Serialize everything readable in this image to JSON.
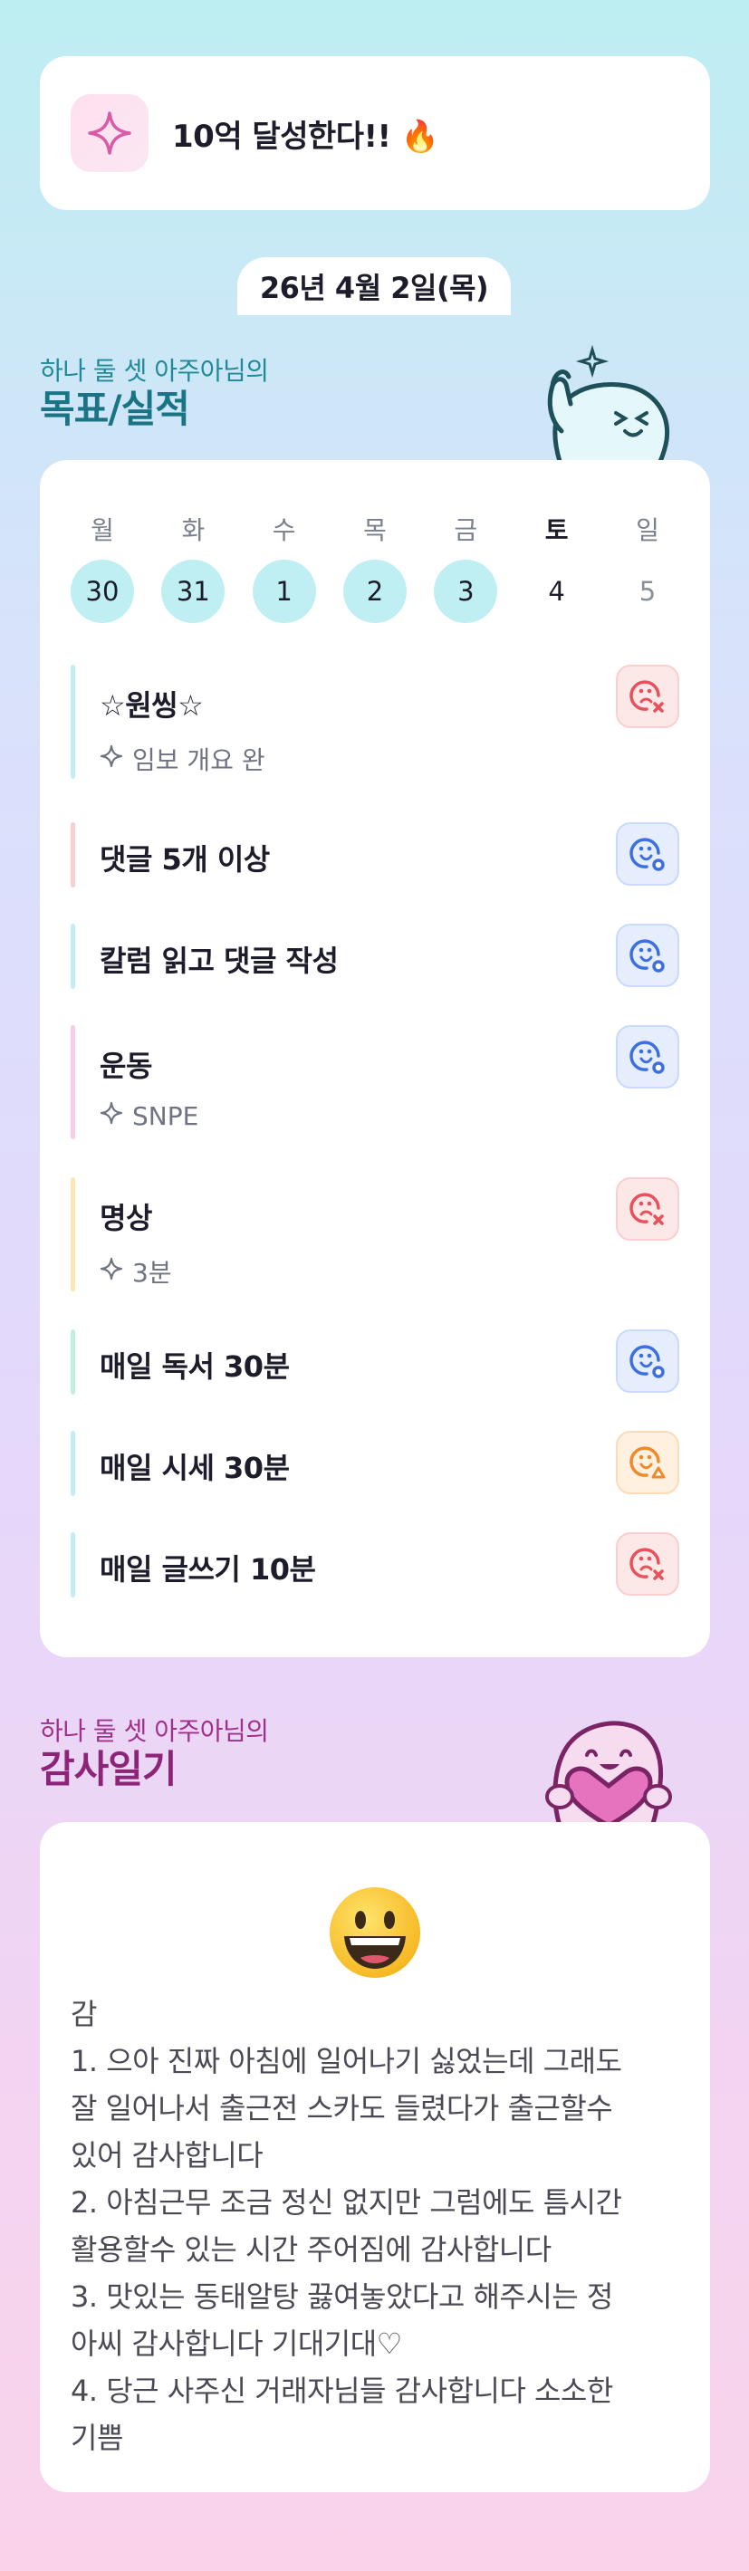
{
  "goal": {
    "text": "10억 달성한다!! 🔥",
    "icon": "sparkle-icon"
  },
  "date": "26년 4월 2일(목)",
  "goals_section": {
    "subtitle": "하나 둘 셋 아주아님의",
    "title": "목표/실적"
  },
  "week": [
    {
      "label": "월",
      "num": "30",
      "state": "done"
    },
    {
      "label": "화",
      "num": "31",
      "state": "done"
    },
    {
      "label": "수",
      "num": "1",
      "state": "done"
    },
    {
      "label": "목",
      "num": "2",
      "state": "done"
    },
    {
      "label": "금",
      "num": "3",
      "state": "done"
    },
    {
      "label": "토",
      "num": "4",
      "state": "today"
    },
    {
      "label": "일",
      "num": "5",
      "state": "future"
    }
  ],
  "tasks": [
    {
      "name": "☆원씽☆",
      "sub": "임보 개요 완",
      "status": "fail",
      "color": "#bfeff2"
    },
    {
      "name": "댓글 5개 이상",
      "sub": "",
      "status": "ok",
      "color": "#f8cfcf"
    },
    {
      "name": "칼럼 읽고 댓글 작성",
      "sub": "",
      "status": "ok",
      "color": "#bfeff2"
    },
    {
      "name": "운동",
      "sub": "SNPE",
      "status": "ok",
      "color": "#f8cde5"
    },
    {
      "name": "명상",
      "sub": "3분",
      "status": "fail",
      "color": "#fbe7b4"
    },
    {
      "name": "매일 독서 30분",
      "sub": "",
      "status": "ok",
      "color": "#bff0e2"
    },
    {
      "name": "매일 시세 30분",
      "sub": "",
      "status": "warn",
      "color": "#bfeff2"
    },
    {
      "name": "매일 글쓰기 10분",
      "sub": "",
      "status": "fail",
      "color": "#bfeff2"
    }
  ],
  "thanks_section": {
    "subtitle": "하나 둘 셋 아주아님의",
    "title": "감사일기"
  },
  "journal": {
    "emoji": "grinning-face-icon",
    "lines": [
      "감",
      "1. 으아 진짜 아침에 일어나기 싫었는데 그래도",
      "잘 일어나서 출근전 스카도 들렸다가 출근할수",
      "있어 감사합니다",
      "2. 아침근무 조금 정신 없지만 그럼에도 틈시간",
      "활용할수 있는 시간 주어짐에 감사합니다",
      "3. 맛있는 동태알탕 끓여놓았다고 해주시는 정",
      "아씨 감사합니다 기대기대♡",
      "4. 당근 사주신 거래자님들 감사합니다 소소한",
      "기쁨"
    ]
  }
}
